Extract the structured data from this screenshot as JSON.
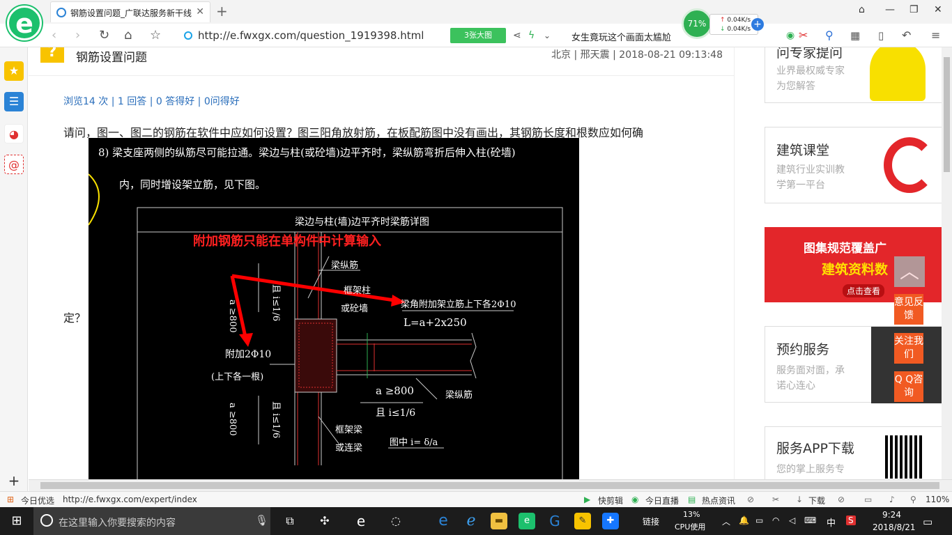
{
  "browser": {
    "tab_title": "钢筋设置问题_广联达服务新干线",
    "url": "http://e.fwxgx.com/question_1919398.html",
    "big_image_btn": "3张大图",
    "news_text": "女生竟玩这个画面太尴尬",
    "net_percent": "71%",
    "net_up": "0.04K/s",
    "net_down": "0.04K/s"
  },
  "question": {
    "title": "钢筋设置问题",
    "meta": "北京 | 邢天震 | 2018-08-21 09:13:48",
    "stats": "浏览14 次 | 1 回答 | 0 答得好 | 0问得好",
    "body_line1": "请问，图一、图二的钢筋在软件中应如何设置？图三阳角放射筋，在板配筋图中没有画出，其钢筋长度和根数应如何确",
    "body_line2": "定？"
  },
  "cad": {
    "note_line1": "8) 梁支座两侧的纵筋尽可能拉通。梁边与柱(或砼墙)边平齐时，梁纵筋弯折后伸入柱(砼墙)",
    "note_line2": "内，同时增设架立筋，见下图。",
    "table_title": "梁边与柱(墙)边平齐时梁筋详图",
    "red_note": "附加钢筋只能在单构件中计算输入",
    "lbl_liang_zong": "梁纵筋",
    "lbl_kuangjia": "框架柱",
    "lbl_huoqiang": "或砼墙",
    "lbl_jialijin": "梁角附加架立筋上下各2Φ10",
    "lbl_L": "L=a+2x250",
    "lbl_fujia": "附加2Φ10",
    "lbl_shangxia": "(上下各一根)",
    "lbl_a800": "a ≥800",
    "lbl_qie": "且 i≤1/6",
    "lbl_liang_zong2": "梁纵筋",
    "lbl_kjl": "框架梁",
    "lbl_lianl": "或连梁",
    "lbl_tuzhong": "图中  i=  δ/a",
    "lbl_a800v": "a ≥800",
    "lbl_qiev": "且 i≤1/6",
    "lbl_a800v2": "a ≥800",
    "lbl_qiev2": "且 i≤1/6"
  },
  "sidebar_right": {
    "card1_title": "问专家提问",
    "card1_sub1": "业界最权威专家",
    "card1_sub2": "为您解答",
    "card2_title": "建筑课堂",
    "card2_sub1": "建筑行业实训教",
    "card2_sub2": "学第一平台",
    "banner_l1": "图集规范覆盖广",
    "banner_l2": "建筑资料数",
    "banner_l3": "点击查看",
    "card3_title": "预约服务",
    "card3_sub1": "服务面对面，承",
    "card3_sub2": "诺心连心",
    "card4_title": "服务APP下载",
    "card4_sub1": "您的掌上服务专"
  },
  "float_buttons": {
    "feedback": "意见反馈",
    "follow": "关注我们",
    "qq": "Q Q咨询"
  },
  "statusbar": {
    "today": "今日优选",
    "link": "http://e.fwxgx.com/expert/index",
    "kuaijian": "快剪辑",
    "zhibo": "今日直播",
    "redian": "热点资讯",
    "xiazai": "下载",
    "zoom": "110%"
  },
  "taskbar": {
    "search_placeholder": "在这里输入你要搜索的内容",
    "link_label": "链接",
    "cpu_pct": "13%",
    "cpu_label": "CPU使用",
    "ime": "中",
    "time": "9:24",
    "date": "2018/8/21"
  }
}
